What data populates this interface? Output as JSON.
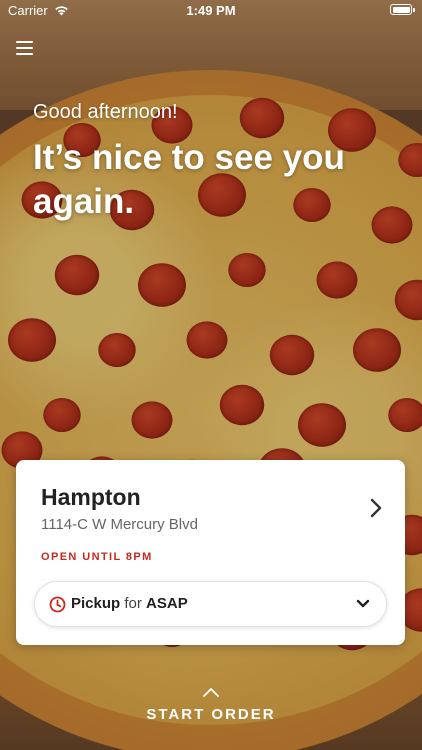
{
  "status_bar": {
    "carrier": "Carrier",
    "time": "1:49 PM",
    "wifi_icon": "wifi-icon",
    "battery_icon": "battery-icon"
  },
  "header": {
    "menu_icon": "hamburger-menu-icon"
  },
  "hero": {
    "greeting": "Good afternoon!",
    "headline": "It’s nice to see you again.",
    "background": "pepperoni-pizza-photo"
  },
  "location_card": {
    "name": "Hampton",
    "address": "1114-C W Mercury Blvd",
    "hours": "OPEN UNTIL 8PM",
    "chevron_icon": "chevron-right-icon",
    "order_type": {
      "method": "Pickup",
      "connector": "for",
      "time": "ASAP",
      "clock_icon": "clock-icon",
      "dropdown_icon": "chevron-down-icon"
    }
  },
  "footer": {
    "start_order": "START ORDER",
    "chevron_icon": "chevron-up-icon"
  },
  "colors": {
    "accent_red": "#c8281e",
    "text_dark": "#222222",
    "text_muted": "#666666"
  }
}
